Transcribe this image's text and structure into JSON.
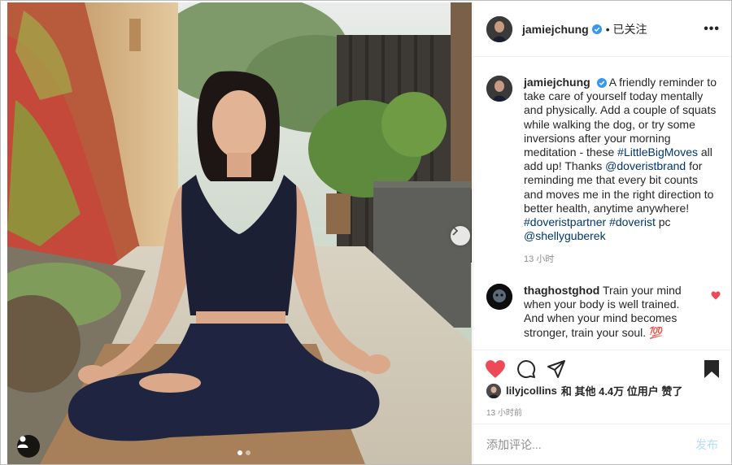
{
  "post": {
    "author": "jamiejchung",
    "follow_status": "• 已关注",
    "caption_segments": [
      {
        "t": "A friendly reminder to take care of yourself today mentally and physically. Add a couple of squats while walking the dog, or try some inversions after your morning meditation - these ",
        "hl": false
      },
      {
        "t": "#LittleBigMoves",
        "hl": true
      },
      {
        "t": " all add up! Thanks ",
        "hl": false
      },
      {
        "t": "@doveristbrand",
        "hl": true
      },
      {
        "t": " for reminding me that every bit counts and moves me in the right direction to better health, anytime anywhere! ",
        "hl": false
      },
      {
        "t": "#doveristpartner",
        "hl": true
      },
      {
        "t": " ",
        "hl": false
      },
      {
        "t": "#doverist",
        "hl": true
      },
      {
        "t": " pc ",
        "hl": false
      },
      {
        "t": "@shellyguberek",
        "hl": true
      }
    ],
    "caption_time": "13 小时",
    "time_ago": "13 小时前"
  },
  "comment": {
    "user": "thaghostghod",
    "text": "Train your mind when your body is well trained. And when your mind becomes stronger, train your soul. 💯"
  },
  "likes": {
    "user": "lilyjcollins",
    "text": "和 其他 4.4万 位用户 赞了"
  },
  "composer": {
    "placeholder": "添加评论...",
    "publish_label": "发布"
  },
  "icons": {
    "liked_heart": "heart-filled-icon",
    "comment": "comment-bubble-icon",
    "share": "paper-plane-icon",
    "save": "bookmark-filled-icon",
    "more": "more-dots-icon",
    "next": "chevron-right-icon",
    "tag": "user-tag-icon",
    "verified": "verified-badge-icon"
  },
  "more_glyph": "•••",
  "carousel": {
    "slides": 2,
    "active": 1
  },
  "colors": {
    "like_red": "#ed4956",
    "link_blue": "#00376b",
    "verified_blue": "#3897f0",
    "muted": "#8e8e8e",
    "publish_disabled": "#b2dffc"
  }
}
